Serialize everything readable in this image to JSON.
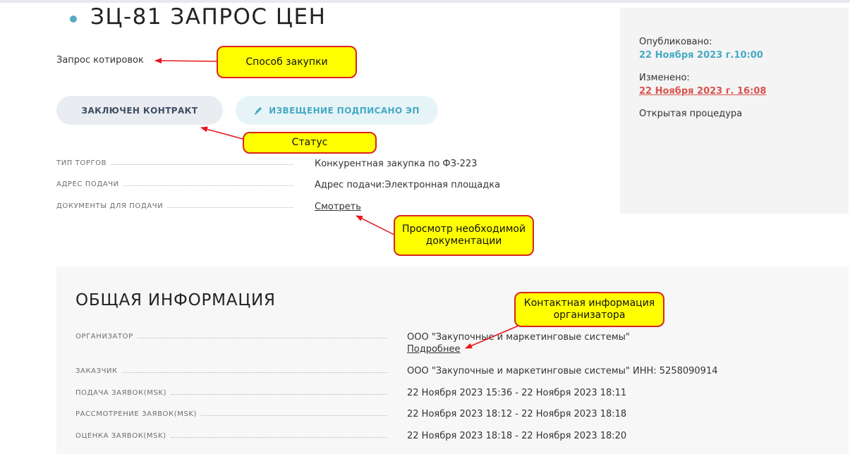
{
  "header": {
    "title": "ЗЦ-81 ЗАПРОС ЦЕН",
    "method": "Запрос котировок"
  },
  "status_buttons": {
    "status": "ЗАКЛЮЧЕН КОНТРАКТ",
    "signed": "ИЗВЕЩЕНИЕ ПОДПИСАНО ЭП"
  },
  "details": [
    {
      "label": "ТИП ТОРГОВ",
      "value": "Конкурентная закупка по ФЗ-223"
    },
    {
      "label": "АДРЕС ПОДАЧИ",
      "value": "Адрес подачи:Электронная площадка"
    },
    {
      "label": "ДОКУМЕНТЫ ДЛЯ ПОДАЧИ",
      "value": "Смотреть"
    }
  ],
  "sidebar": {
    "published_label": "Опубликовано:",
    "published_value": "22 Ноября 2023 г.10:00",
    "changed_label": "Изменено:",
    "changed_value": "22 Ноября 2023 г. 16:08",
    "procedure": "Открытая процедура"
  },
  "general": {
    "heading": "ОБЩАЯ ИНФОРМАЦИЯ",
    "rows": [
      {
        "label": "ОРГАНИЗАТОР",
        "value": "ООО \"Закупочные и маркетинговые системы\"",
        "link": "Подробнее"
      },
      {
        "label": "ЗАКАЗЧИК",
        "value": "ООО \"Закупочные и маркетинговые системы\" ИНН: 5258090914"
      },
      {
        "label": "ПОДАЧА ЗАЯВОК(MSK)",
        "value": "22 Ноября 2023 15:36 - 22 Ноября 2023 18:11"
      },
      {
        "label": "РАССМОТРЕНИЕ ЗАЯВОК(MSK)",
        "value": "22 Ноября 2023 18:12 - 22 Ноября 2023 18:18"
      },
      {
        "label": "ОЦЕНКА ЗАЯВОК(MSK)",
        "value": "22 Ноября 2023 18:18 - 22 Ноября 2023 18:20"
      }
    ]
  },
  "callouts": {
    "method": "Способ закупки",
    "status": "Статус",
    "docs": "Просмотр необходимой документации",
    "contact": "Контактная информация организатора"
  },
  "colors": {
    "accent": "#46a9c4",
    "changed": "#d9534f",
    "callout_bg": "#ffff00",
    "callout_border": "#d9251d"
  },
  "icons": {
    "signed": "pen-icon",
    "bullet": "status-dot-icon"
  }
}
